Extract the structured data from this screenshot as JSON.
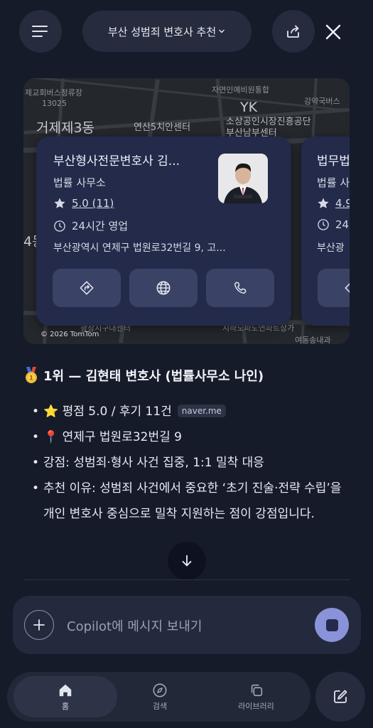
{
  "header": {
    "title": "부산 성범죄 변호사 추천"
  },
  "map": {
    "labels": {
      "l1": "제교회버스정류장",
      "l2": "13025",
      "l3": "거제제3동",
      "l4": "연산5치안센터",
      "l5": "YK",
      "l6": "소상공인시장진흥공단",
      "l7": "부산남부센터",
      "l8": "자연인예비원통합",
      "l9": "강약국버스",
      "l10": "4동",
      "l11": "광장지구대센터",
      "l12": "지하도파도연파트상가",
      "l13": "여동송내과"
    },
    "attribution": "© 2026 TomTom"
  },
  "cards": [
    {
      "name": "부산형사전문변호사 김...",
      "type": "법률 사무소",
      "rating": "5.0 (11)",
      "hours": "24시간 영업",
      "address": "부산광역시 연제구 법원로32번길 9, 고..."
    },
    {
      "name": "법무법",
      "type": "법률 사",
      "rating": "4.9",
      "hours": "24",
      "address": "부산광"
    }
  ],
  "content": {
    "heading": "1위 — 김현태 변호사 (법률사무소 나인)",
    "bullets": [
      {
        "text": "⭐ 평점 5.0 / 후기 11건",
        "chip": "naver.me"
      },
      {
        "text": "📍 연제구 법원로32번길 9"
      },
      {
        "text": "강점: 성범죄·형사 사건 집중, 1:1 밀착 대응"
      },
      {
        "text": "추천 이유: 성범죄 사건에서 중요한 ‘초기 진술·전략 수립’을 개인 변호사 중심으로 밀착 지원하는 점이 강점입니다."
      }
    ]
  },
  "input": {
    "placeholder": "Copilot에 메시지 보내기"
  },
  "nav": {
    "home": "홈",
    "search": "검색",
    "library": "라이브러리"
  },
  "colors": {
    "background": "#161b2a",
    "card": "#232a4a",
    "accent": "#8a93d9"
  }
}
